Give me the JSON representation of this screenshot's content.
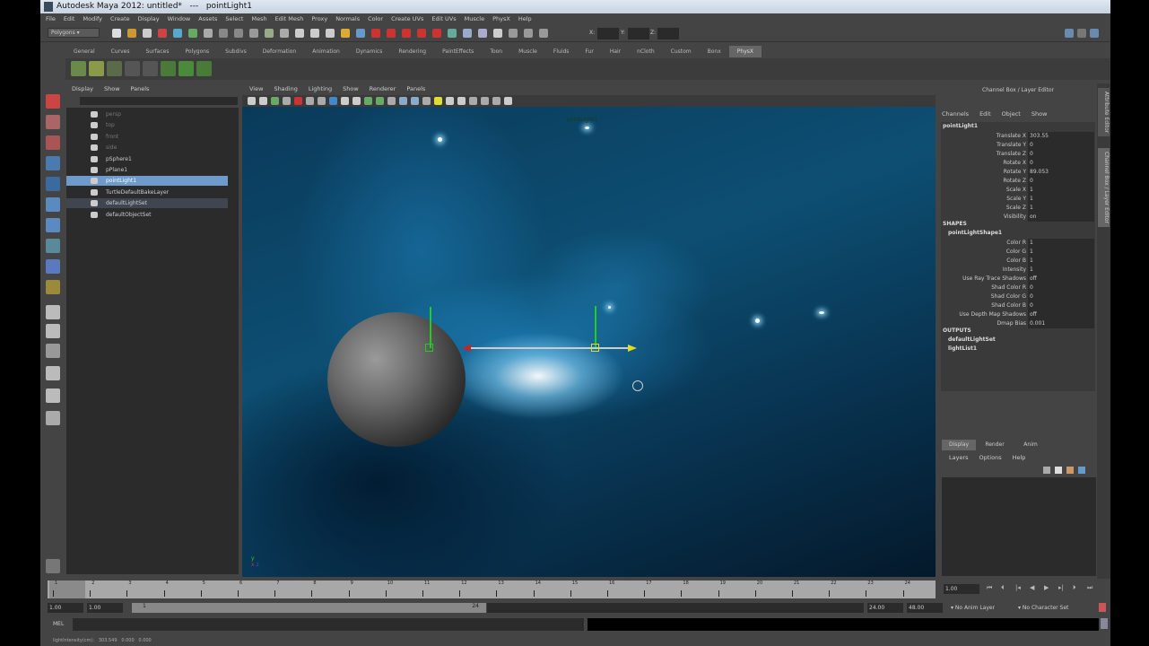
{
  "window": {
    "app_title": "Autodesk Maya 2012: untitled*",
    "separator": "---",
    "selection": "pointLight1"
  },
  "menubar": [
    "File",
    "Edit",
    "Modify",
    "Create",
    "Display",
    "Window",
    "Assets",
    "Select",
    "Mesh",
    "Edit Mesh",
    "Proxy",
    "Normals",
    "Color",
    "Create UVs",
    "Edit UVs",
    "Muscle",
    "PhysX",
    "Help"
  ],
  "status_line": {
    "menuset": "Polygons",
    "x_label": "X:",
    "y_label": "Y:",
    "z_label": "Z:"
  },
  "shelf_tabs": [
    "General",
    "Curves",
    "Surfaces",
    "Polygons",
    "Subdivs",
    "Deformation",
    "Animation",
    "Dynamics",
    "Rendering",
    "PaintEffects",
    "Toon",
    "Muscle",
    "Fluids",
    "Fur",
    "Hair",
    "nCloth",
    "Custom",
    "Bonx",
    "PhysX"
  ],
  "shelf_active": "PhysX",
  "outliner": {
    "menu": [
      "Display",
      "Show",
      "Panels"
    ],
    "items": [
      {
        "label": "persp",
        "state": "dim"
      },
      {
        "label": "top",
        "state": "dim"
      },
      {
        "label": "front",
        "state": "dim"
      },
      {
        "label": "side",
        "state": "dim"
      },
      {
        "label": "pSphere1",
        "state": "normal"
      },
      {
        "label": "pPlane1",
        "state": "normal"
      },
      {
        "label": "pointLight1",
        "state": "selected"
      },
      {
        "label": "TurtleDefaultBakeLayer",
        "state": "normal"
      },
      {
        "label": "defaultLightSet",
        "state": "highlight"
      },
      {
        "label": "defaultObjectSet",
        "state": "normal"
      }
    ]
  },
  "viewport": {
    "menu": [
      "View",
      "Shading",
      "Lighting",
      "Show",
      "Renderer",
      "Panels"
    ],
    "object_label": "pointLight1",
    "axis_y": "y",
    "axis_x": "x",
    "axis_z": "z"
  },
  "channel_box": {
    "title": "Channel Box / Layer Editor",
    "menu": [
      "Channels",
      "Edit",
      "Object",
      "Show"
    ],
    "node": "pointLight1",
    "channels": [
      {
        "label": "Translate X",
        "value": "303.55"
      },
      {
        "label": "Translate Y",
        "value": "0"
      },
      {
        "label": "Translate Z",
        "value": "0"
      },
      {
        "label": "Rotate X",
        "value": "0"
      },
      {
        "label": "Rotate Y",
        "value": "89.053"
      },
      {
        "label": "Rotate Z",
        "value": "0"
      },
      {
        "label": "Scale X",
        "value": "1"
      },
      {
        "label": "Scale Y",
        "value": "1"
      },
      {
        "label": "Scale Z",
        "value": "1"
      },
      {
        "label": "Visibility",
        "value": "on"
      }
    ],
    "shapes_header": "SHAPES",
    "shape_node": "pointLightShape1",
    "shape_channels": [
      {
        "label": "Color R",
        "value": "1"
      },
      {
        "label": "Color G",
        "value": "1"
      },
      {
        "label": "Color B",
        "value": "1"
      },
      {
        "label": "Intensity",
        "value": "1"
      },
      {
        "label": "Use Ray Trace Shadows",
        "value": "off"
      },
      {
        "label": "Shad Color R",
        "value": "0"
      },
      {
        "label": "Shad Color G",
        "value": "0"
      },
      {
        "label": "Shad Color B",
        "value": "0"
      },
      {
        "label": "Use Depth Map Shadows",
        "value": "off"
      },
      {
        "label": "Dmap Bias",
        "value": "0.001"
      }
    ],
    "outputs_header": "OUTPUTS",
    "outputs": [
      "defaultLightSet",
      "lightList1"
    ]
  },
  "side_tabs": [
    "Attribute Editor",
    "Channel Box / Layer Editor"
  ],
  "layer_editor": {
    "tabs": [
      "Display",
      "Render",
      "Anim"
    ],
    "menu": [
      "Layers",
      "Options",
      "Help"
    ]
  },
  "timeline": {
    "ticks": [
      "1",
      "2",
      "3",
      "4",
      "5",
      "6",
      "7",
      "8",
      "9",
      "10",
      "11",
      "12",
      "13",
      "14",
      "15",
      "16",
      "17",
      "18",
      "19",
      "20",
      "21",
      "22",
      "23",
      "24"
    ],
    "current_frame": "1.00",
    "playback_start": "1.00",
    "range_start": "1.00",
    "range_slider_start": "1",
    "range_slider_end": "24",
    "playback_end": "24.00",
    "range_end": "48.00",
    "anim_layer": "No Anim Layer",
    "character_set": "No Character Set"
  },
  "command_line": {
    "label": "MEL"
  },
  "help_line": {
    "label": "lightIntensity(cm):",
    "values": [
      "303.549",
      "0.000",
      "0.000"
    ]
  }
}
